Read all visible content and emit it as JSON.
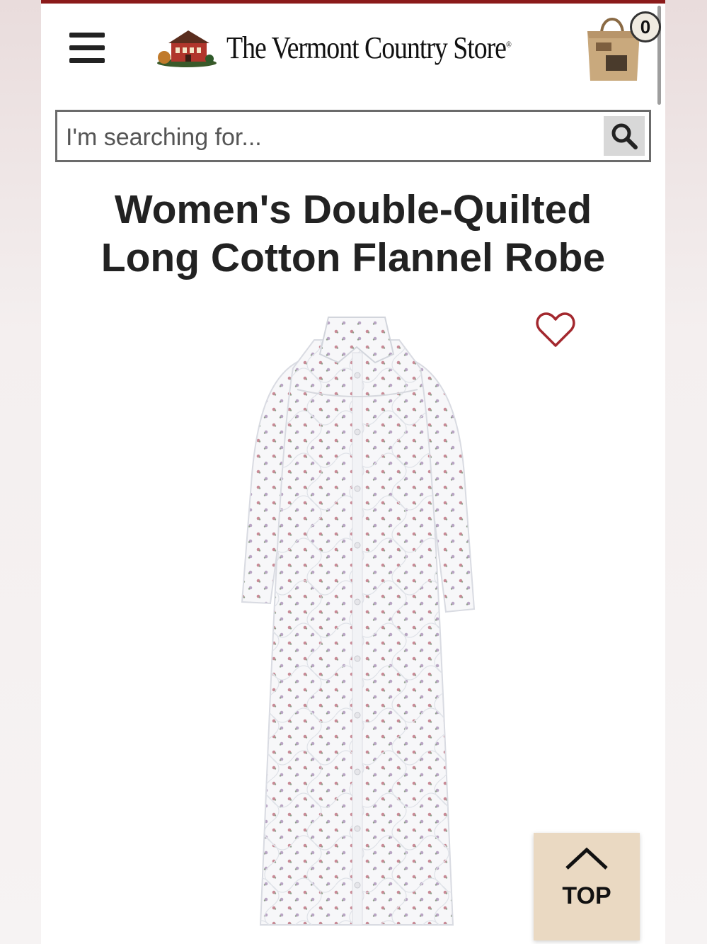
{
  "header": {
    "store_name": "The Vermont Country Store",
    "store_mark": "®",
    "cart_count": "0"
  },
  "search": {
    "placeholder": "I'm searching for..."
  },
  "product": {
    "title_line1": "Women's Double-Quilted",
    "title_line2": "Long Cotton Flannel Robe"
  },
  "back_to_top": {
    "label": "TOP"
  },
  "colors": {
    "accent_bar": "#8b1a1a",
    "heart": "#a3282e",
    "top_button_bg": "#ead9c2"
  },
  "icons": {
    "menu": "hamburger-icon",
    "logo": "store-house-icon",
    "cart": "shopping-bag-icon",
    "search": "search-icon",
    "wishlist": "heart-icon",
    "back_to_top": "chevron-up-icon"
  }
}
